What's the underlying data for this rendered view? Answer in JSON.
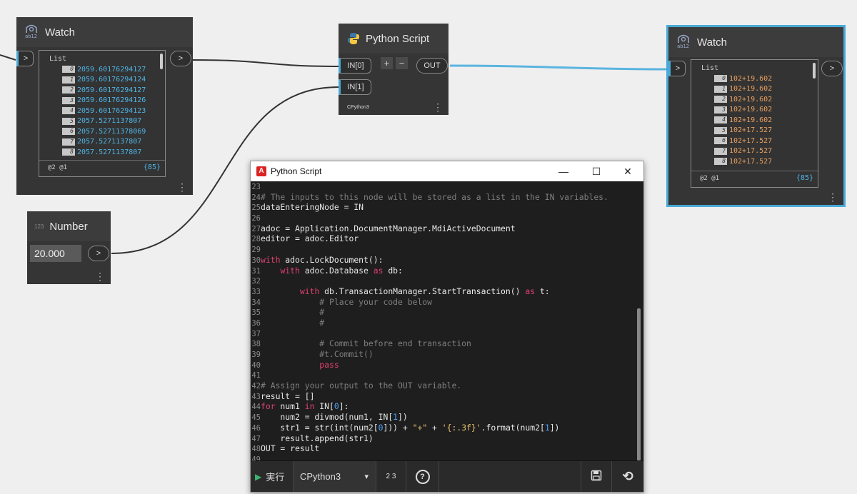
{
  "watch_left": {
    "title": "Watch",
    "icon_text": "ab12",
    "input_port": ">",
    "output_port": ">",
    "list_label": "List",
    "items": [
      {
        "index": "0",
        "value": "2059.60176294127"
      },
      {
        "index": "1",
        "value": "2059.60176294124"
      },
      {
        "index": "2",
        "value": "2059.60176294127"
      },
      {
        "index": "3",
        "value": "2059.60176294126"
      },
      {
        "index": "4",
        "value": "2059.60176294123"
      },
      {
        "index": "5",
        "value": "2057.5271137807"
      },
      {
        "index": "6",
        "value": "2057.52711378069"
      },
      {
        "index": "7",
        "value": "2057.5271137807"
      },
      {
        "index": "8",
        "value": "2057.5271137807"
      }
    ],
    "levels": "@2 @1",
    "count": "{85}"
  },
  "number_node": {
    "title": "Number",
    "icon_text": "123",
    "value": "20.000",
    "output_port": ">"
  },
  "python_node": {
    "title": "Python Script",
    "in0": "IN[0]",
    "in1": "IN[1]",
    "add_label": "+",
    "remove_label": "−",
    "out": "OUT",
    "engine": "CPython3"
  },
  "watch_right": {
    "title": "Watch",
    "icon_text": "ab12",
    "input_port": ">",
    "output_port": ">",
    "list_label": "List",
    "items": [
      {
        "index": "0",
        "value": "102+19.602"
      },
      {
        "index": "1",
        "value": "102+19.602"
      },
      {
        "index": "2",
        "value": "102+19.602"
      },
      {
        "index": "3",
        "value": "102+19.602"
      },
      {
        "index": "4",
        "value": "102+19.602"
      },
      {
        "index": "5",
        "value": "102+17.527"
      },
      {
        "index": "6",
        "value": "102+17.527"
      },
      {
        "index": "7",
        "value": "102+17.527"
      },
      {
        "index": "8",
        "value": "102+17.527"
      }
    ],
    "levels": "@2 @1",
    "count": "{85}"
  },
  "editor": {
    "window_title": "Python Script",
    "minimize": "—",
    "maximize": "☐",
    "close": "✕",
    "lines": [
      {
        "n": "23",
        "segs": [
          [
            "tx",
            ""
          ]
        ]
      },
      {
        "n": "24",
        "segs": [
          [
            "c-com",
            "# The inputs to this node will be stored as a list in the IN variables."
          ]
        ]
      },
      {
        "n": "25",
        "segs": [
          [
            "tx",
            "dataEnteringNode = IN"
          ]
        ]
      },
      {
        "n": "26",
        "segs": [
          [
            "tx",
            ""
          ]
        ]
      },
      {
        "n": "27",
        "segs": [
          [
            "tx",
            "adoc = Application.DocumentManager.MdiActiveDocument"
          ]
        ]
      },
      {
        "n": "28",
        "segs": [
          [
            "tx",
            "editor = adoc.Editor"
          ]
        ]
      },
      {
        "n": "29",
        "segs": [
          [
            "tx",
            ""
          ]
        ]
      },
      {
        "n": "30",
        "segs": [
          [
            "c-kw",
            "with"
          ],
          [
            "tx",
            " adoc."
          ],
          [
            "c-fn",
            "LockDocument"
          ],
          [
            "tx",
            "():"
          ]
        ]
      },
      {
        "n": "31",
        "segs": [
          [
            "tx",
            "    "
          ],
          [
            "c-kw",
            "with"
          ],
          [
            "tx",
            " adoc.Database "
          ],
          [
            "c-kw",
            "as"
          ],
          [
            "tx",
            " db:"
          ]
        ]
      },
      {
        "n": "32",
        "segs": [
          [
            "tx",
            ""
          ]
        ]
      },
      {
        "n": "33",
        "segs": [
          [
            "tx",
            "        "
          ],
          [
            "c-kw",
            "with"
          ],
          [
            "tx",
            " db.TransactionManager."
          ],
          [
            "c-fn",
            "StartTransaction"
          ],
          [
            "tx",
            "() "
          ],
          [
            "c-kw",
            "as"
          ],
          [
            "tx",
            " t:"
          ]
        ]
      },
      {
        "n": "34",
        "segs": [
          [
            "tx",
            "            "
          ],
          [
            "c-com",
            "# Place your code below"
          ]
        ]
      },
      {
        "n": "35",
        "segs": [
          [
            "tx",
            "            "
          ],
          [
            "c-com",
            "#"
          ]
        ]
      },
      {
        "n": "36",
        "segs": [
          [
            "tx",
            "            "
          ],
          [
            "c-com",
            "#"
          ]
        ]
      },
      {
        "n": "37",
        "segs": [
          [
            "tx",
            ""
          ]
        ]
      },
      {
        "n": "38",
        "segs": [
          [
            "tx",
            "            "
          ],
          [
            "c-com",
            "# Commit before end transaction"
          ]
        ]
      },
      {
        "n": "39",
        "segs": [
          [
            "tx",
            "            "
          ],
          [
            "c-com",
            "#t.Commit()"
          ]
        ]
      },
      {
        "n": "40",
        "segs": [
          [
            "tx",
            "            "
          ],
          [
            "c-kw",
            "pass"
          ]
        ]
      },
      {
        "n": "41",
        "segs": [
          [
            "tx",
            ""
          ]
        ]
      },
      {
        "n": "42",
        "segs": [
          [
            "c-com",
            "# Assign your output to the OUT variable."
          ]
        ]
      },
      {
        "n": "43",
        "segs": [
          [
            "tx",
            "result = []"
          ]
        ]
      },
      {
        "n": "44",
        "segs": [
          [
            "c-kw",
            "for"
          ],
          [
            "tx",
            " num1 "
          ],
          [
            "c-kw",
            "in"
          ],
          [
            "tx",
            " IN["
          ],
          [
            "c-num",
            "0"
          ],
          [
            "tx",
            "]:"
          ]
        ]
      },
      {
        "n": "45",
        "segs": [
          [
            "tx",
            "    num2 = "
          ],
          [
            "c-fn",
            "divmod"
          ],
          [
            "tx",
            "(num1, IN["
          ],
          [
            "c-num",
            "1"
          ],
          [
            "tx",
            "])"
          ]
        ]
      },
      {
        "n": "46",
        "segs": [
          [
            "tx",
            "    str1 = "
          ],
          [
            "c-fn",
            "str"
          ],
          [
            "tx",
            "("
          ],
          [
            "c-fn",
            "int"
          ],
          [
            "tx",
            "(num2["
          ],
          [
            "c-num",
            "0"
          ],
          [
            "tx",
            "])) + "
          ],
          [
            "c-str",
            "\"+\""
          ],
          [
            "tx",
            " + "
          ],
          [
            "c-str",
            "'{:.3f}'"
          ],
          [
            "tx",
            "."
          ],
          [
            "c-fn",
            "format"
          ],
          [
            "tx",
            "(num2["
          ],
          [
            "c-num",
            "1"
          ],
          [
            "tx",
            "])"
          ]
        ]
      },
      {
        "n": "47",
        "segs": [
          [
            "tx",
            "    result."
          ],
          [
            "c-fn",
            "append"
          ],
          [
            "tx",
            "(str1)"
          ]
        ]
      },
      {
        "n": "48",
        "segs": [
          [
            "tx",
            "OUT = result"
          ]
        ]
      },
      {
        "n": "49",
        "segs": [
          [
            "tx",
            ""
          ]
        ]
      }
    ],
    "toolbar": {
      "run_label": "実行",
      "engine": "CPython3",
      "dropdown_arrow": "▾",
      "indent_glyph": "2 3",
      "help_glyph": "?",
      "save_glyph": "💾",
      "revert_glyph": "⟲"
    }
  },
  "colors": {
    "wire_selected": "#5ab4e0",
    "wire_default": "#333333",
    "selection_border": "#4aa9d6"
  }
}
